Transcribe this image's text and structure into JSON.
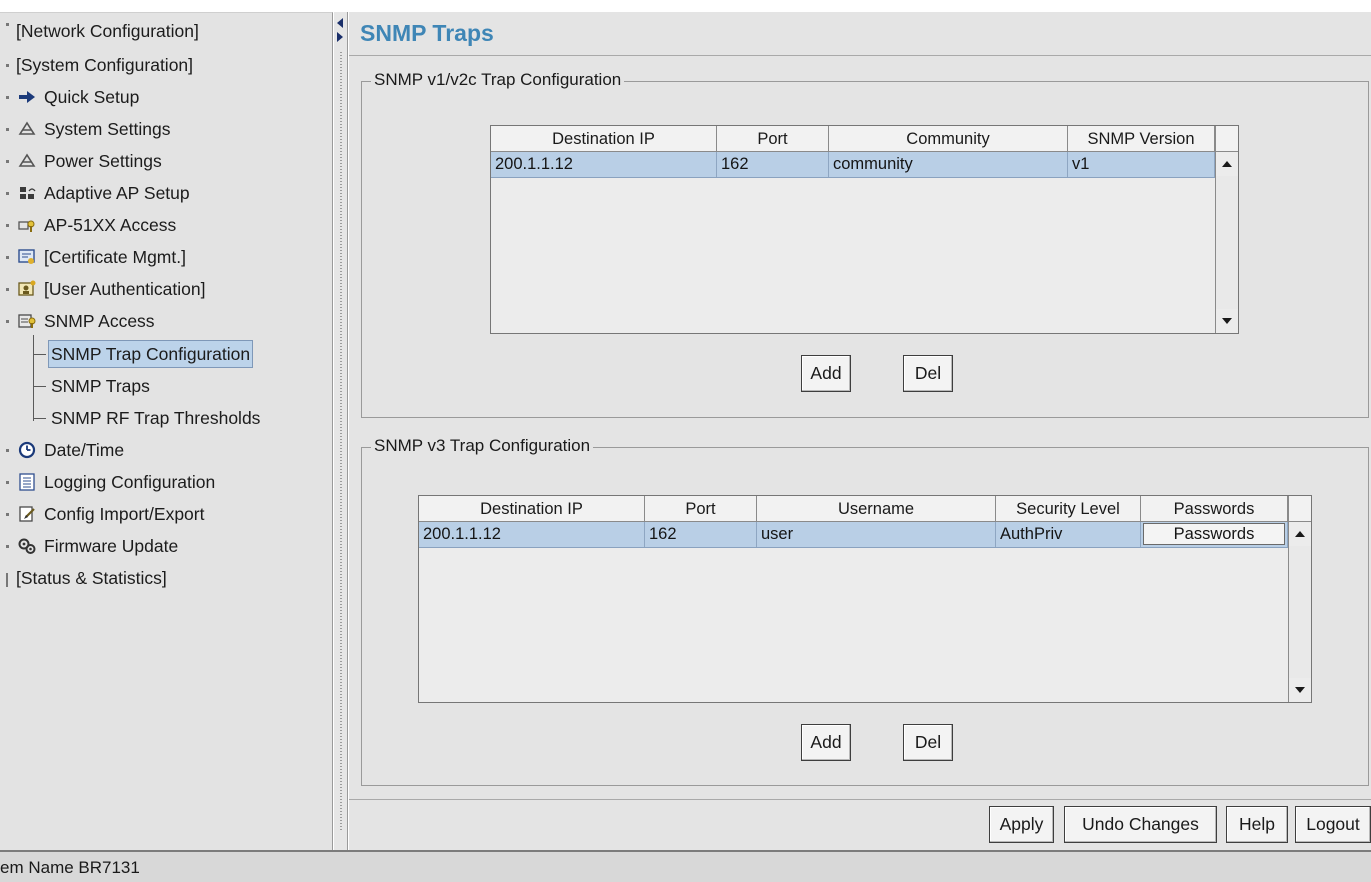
{
  "tree": {
    "items": [
      {
        "label": "[Network Configuration]",
        "icon": "folder-marker"
      },
      {
        "label": "[System Configuration]",
        "icon": "folder-marker"
      },
      {
        "label": "Quick Setup",
        "icon": "arrow-right-icon"
      },
      {
        "label": "System Settings",
        "icon": "settings-icon"
      },
      {
        "label": "Power Settings",
        "icon": "settings-icon"
      },
      {
        "label": "Adaptive AP Setup",
        "icon": "access-point-icon"
      },
      {
        "label": "AP-51XX Access",
        "icon": "key-icon"
      },
      {
        "label": "[Certificate Mgmt.]",
        "icon": "certificate-icon"
      },
      {
        "label": "[User Authentication]",
        "icon": "user-auth-icon"
      },
      {
        "label": "SNMP Access",
        "icon": "snmp-key-icon"
      },
      {
        "label": "SNMP Trap Configuration",
        "icon": ""
      },
      {
        "label": "SNMP Traps",
        "icon": ""
      },
      {
        "label": "SNMP RF Trap Thresholds",
        "icon": ""
      },
      {
        "label": "Date/Time",
        "icon": "clock-icon"
      },
      {
        "label": "Logging Configuration",
        "icon": "log-icon"
      },
      {
        "label": "Config Import/Export",
        "icon": "import-export-icon"
      },
      {
        "label": "Firmware Update",
        "icon": "gears-icon"
      },
      {
        "label": "[Status & Statistics]",
        "icon": ""
      }
    ],
    "selected": "SNMP Trap Configuration"
  },
  "page": {
    "title": "SNMP Traps"
  },
  "v1v2c": {
    "legend": "SNMP v1/v2c Trap Configuration",
    "columns": [
      "Destination IP",
      "Port",
      "Community",
      "SNMP Version"
    ],
    "rows": [
      [
        "200.1.1.12",
        "162",
        "community",
        "v1"
      ]
    ],
    "add_label": "Add",
    "del_label": "Del"
  },
  "v3": {
    "legend": "SNMP v3 Trap Configuration",
    "columns": [
      "Destination IP",
      "Port",
      "Username",
      "Security Level",
      "Passwords"
    ],
    "rows": [
      [
        "200.1.1.12",
        "162",
        "user",
        "AuthPriv",
        "Passwords"
      ]
    ],
    "add_label": "Add",
    "del_label": "Del"
  },
  "footer": {
    "apply_label": "Apply",
    "undo_label": "Undo Changes",
    "help_label": "Help",
    "logout_label": "Logout"
  },
  "status_bar": {
    "text": "em Name BR7131"
  },
  "colors": {
    "title": "#3f86b6",
    "selection": "#b9cfe6",
    "panel": "#e4e4e4"
  }
}
